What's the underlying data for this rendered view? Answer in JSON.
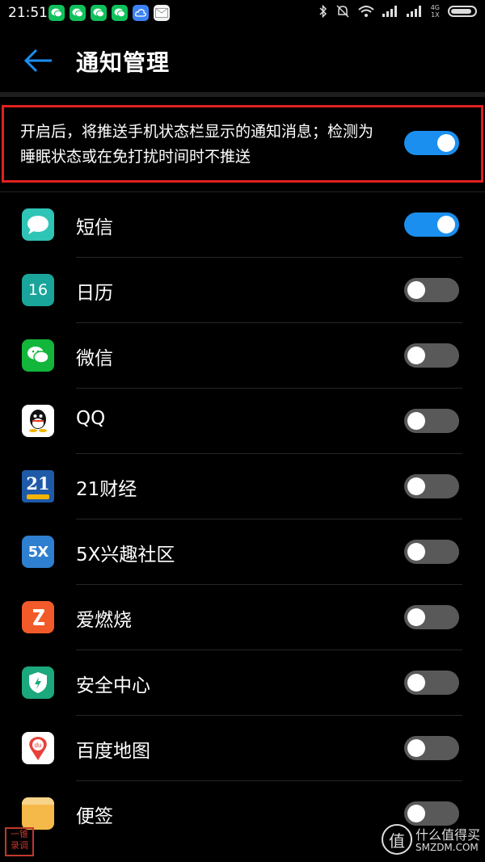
{
  "status_bar": {
    "time": "21:51",
    "notification_icons": [
      "wechat-icon",
      "wechat-icon",
      "wechat-icon",
      "wechat-icon",
      "cloud-icon",
      "mail-icon"
    ],
    "network": "4G",
    "sim": "1X",
    "battery_level": 0.9
  },
  "header": {
    "title": "通知管理"
  },
  "master": {
    "description": "开启后，将推送手机状态栏显示的通知消息；检测为睡眠状态或在免打扰时间时不推送",
    "enabled": true
  },
  "apps": [
    {
      "name": "短信",
      "icon": "sms-icon",
      "color": "#2ec4b6",
      "enabled": true
    },
    {
      "name": "日历",
      "icon": "calendar-icon",
      "color": "#1aa59a",
      "badge": "16",
      "enabled": false
    },
    {
      "name": "微信",
      "icon": "wechat-icon",
      "color": "#12b63a",
      "enabled": false
    },
    {
      "name": "QQ",
      "icon": "qq-icon",
      "color": "#ffffff",
      "enabled": false
    },
    {
      "name": "21财经",
      "icon": "21caijing-icon",
      "color": "#1f5aa8",
      "badge": "21",
      "enabled": false
    },
    {
      "name": "5X兴趣社区",
      "icon": "5x-icon",
      "color": "#2f7fd0",
      "badge": "5X",
      "enabled": false
    },
    {
      "name": "爱燃烧",
      "icon": "burn-icon",
      "color": "#f25a2a",
      "enabled": false
    },
    {
      "name": "安全中心",
      "icon": "shield-icon",
      "color": "#1ba87c",
      "enabled": false
    },
    {
      "name": "百度地图",
      "icon": "baidu-map-icon",
      "color": "#ffffff",
      "badge": "du",
      "enabled": false
    },
    {
      "name": "便签",
      "icon": "note-icon",
      "color": "#f5b94a",
      "enabled": false
    }
  ],
  "colors": {
    "accent": "#1a8ff0",
    "toggle_off": "#595959",
    "highlight_border": "#e02020"
  },
  "watermark": {
    "left_text": "一锥录调",
    "logo_text": "值",
    "site_name": "什么值得买",
    "site_url": "SMZDM.COM"
  }
}
